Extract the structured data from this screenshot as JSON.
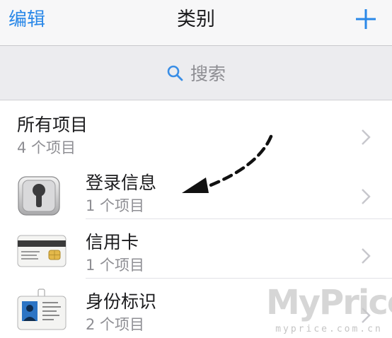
{
  "navbar": {
    "edit_label": "编辑",
    "title": "类别",
    "add_icon": "plus-icon",
    "accent_color": "#2a88e8"
  },
  "search": {
    "placeholder": "搜索",
    "icon": "search-icon"
  },
  "categories": [
    {
      "title": "所有项目",
      "subtitle": "4 个项目",
      "icon": null
    },
    {
      "title": "登录信息",
      "subtitle": "1 个项目",
      "icon": "keyhole-lock-icon"
    },
    {
      "title": "信用卡",
      "subtitle": "1 个项目",
      "icon": "credit-card-icon"
    },
    {
      "title": "身份标识",
      "subtitle": "2 个项目",
      "icon": "id-card-icon"
    }
  ],
  "watermark": {
    "title": "MyPrice",
    "subtitle": "myprice.com.cn"
  }
}
